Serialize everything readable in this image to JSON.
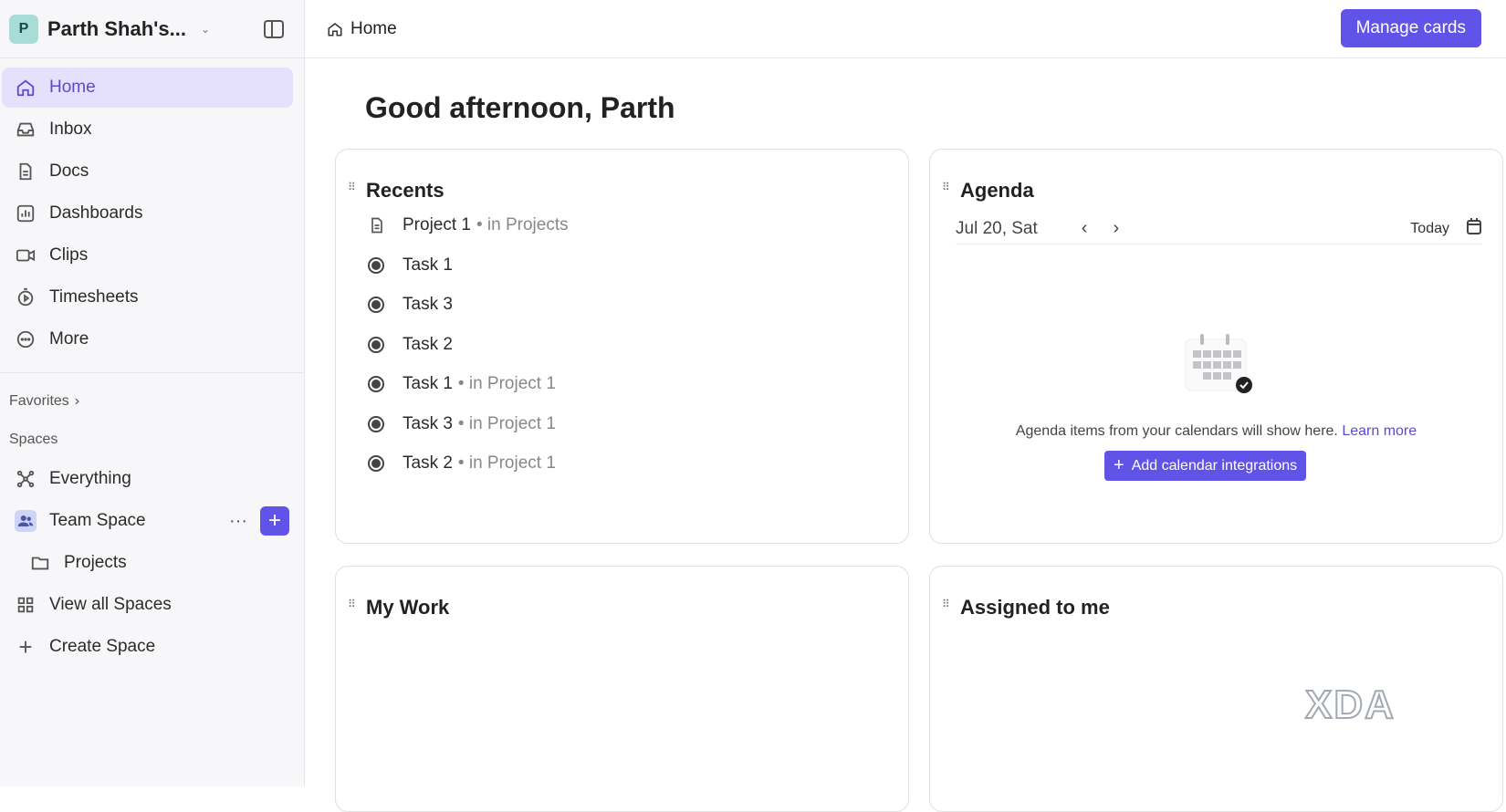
{
  "workspace": {
    "initial": "P",
    "name": "Parth Shah's..."
  },
  "nav": [
    {
      "label": "Home"
    },
    {
      "label": "Inbox"
    },
    {
      "label": "Docs"
    },
    {
      "label": "Dashboards"
    },
    {
      "label": "Clips"
    },
    {
      "label": "Timesheets"
    },
    {
      "label": "More"
    }
  ],
  "favorites_label": "Favorites",
  "spaces_label": "Spaces",
  "spaces": {
    "everything": "Everything",
    "team_space": "Team Space",
    "projects": "Projects",
    "view_all": "View all Spaces",
    "create": "Create Space"
  },
  "breadcrumb": "Home",
  "manage_cards": "Manage cards",
  "greeting": "Good afternoon, Parth",
  "recents": {
    "title": "Recents",
    "items": [
      {
        "name": "Project 1",
        "loc": "• in Projects",
        "type": "doc"
      },
      {
        "name": "Task 1",
        "loc": ""
      },
      {
        "name": "Task 3",
        "loc": ""
      },
      {
        "name": "Task 2",
        "loc": ""
      },
      {
        "name": "Task 1",
        "loc": "• in Project 1"
      },
      {
        "name": "Task 3",
        "loc": "• in Project 1"
      },
      {
        "name": "Task 2",
        "loc": "• in Project 1"
      }
    ]
  },
  "agenda": {
    "title": "Agenda",
    "date": "Jul 20, Sat",
    "today": "Today",
    "empty_text": "Agenda items from your calendars will show here.",
    "learn_more": "Learn more",
    "add_button": "Add calendar integrations"
  },
  "my_work": {
    "title": "My Work"
  },
  "assigned": {
    "title": "Assigned to me"
  },
  "watermark": "XDA",
  "colors": {
    "accent": "#6053e8",
    "active_bg": "#e5e1fc"
  }
}
